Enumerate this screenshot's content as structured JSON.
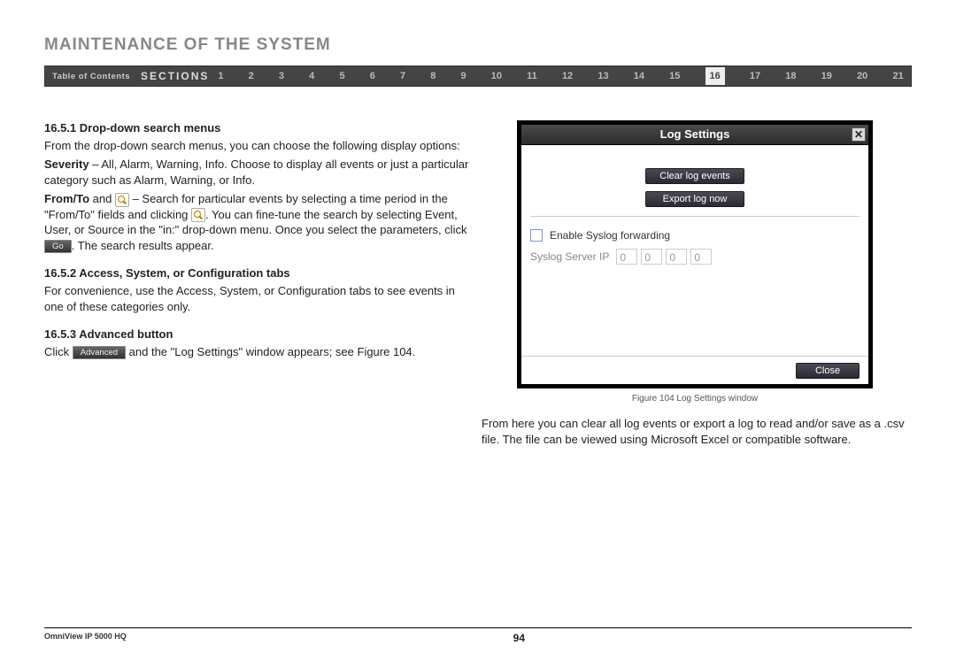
{
  "header": {
    "title": "MAINTENANCE OF THE SYSTEM",
    "toc": "Table of Contents",
    "sections": "SECTIONS",
    "nums": [
      "1",
      "2",
      "3",
      "4",
      "5",
      "6",
      "7",
      "8",
      "9",
      "10",
      "11",
      "12",
      "13",
      "14",
      "15",
      "16",
      "17",
      "18",
      "19",
      "20",
      "21"
    ],
    "active": "16"
  },
  "body": {
    "h1": "16.5.1 Drop-down search menus",
    "p1": "From the drop-down search menus, you can choose the following display options:",
    "sev_bold": "Severity",
    "sev_rest": " – All, Alarm, Warning, Info. Choose to display all events or just a particular category such as Alarm, Warning, or Info.",
    "ft_bold": "From/To",
    "ft_and": " and ",
    "ft_rest1": " – Search for particular events by selecting a time period in the \"From/To\" fields and clicking ",
    "ft_rest2": ". You can fine-tune the search by selecting Event, User, or Source in the \"in:\" drop-down menu. Once you select the parameters, click ",
    "go_label": "Go",
    "ft_rest3": ". The search results appear.",
    "h2": "16.5.2 Access, System, or Configuration tabs",
    "p2": "For convenience, use the Access, System, or Configuration tabs to see events in one of these categories only.",
    "h3": "16.5.3 Advanced button",
    "p3a": "Click ",
    "adv_label": "Advanced",
    "p3b": " and the \"Log Settings\" window appears; see Figure 104."
  },
  "dialog": {
    "title": "Log Settings",
    "clear": "Clear log events",
    "export": "Export log now",
    "enable": "Enable Syslog forwarding",
    "iplabel": "Syslog Server IP",
    "ip": [
      "0",
      "0",
      "0",
      "0"
    ],
    "close": "Close",
    "x": "✕"
  },
  "caption": "Figure 104 Log Settings window",
  "right_para": "From here you can clear all log events or export a log to read and/or save as a .csv file. The file can be viewed using Microsoft Excel or compatible software.",
  "footer": {
    "product": "OmniView IP 5000 HQ",
    "page": "94"
  }
}
